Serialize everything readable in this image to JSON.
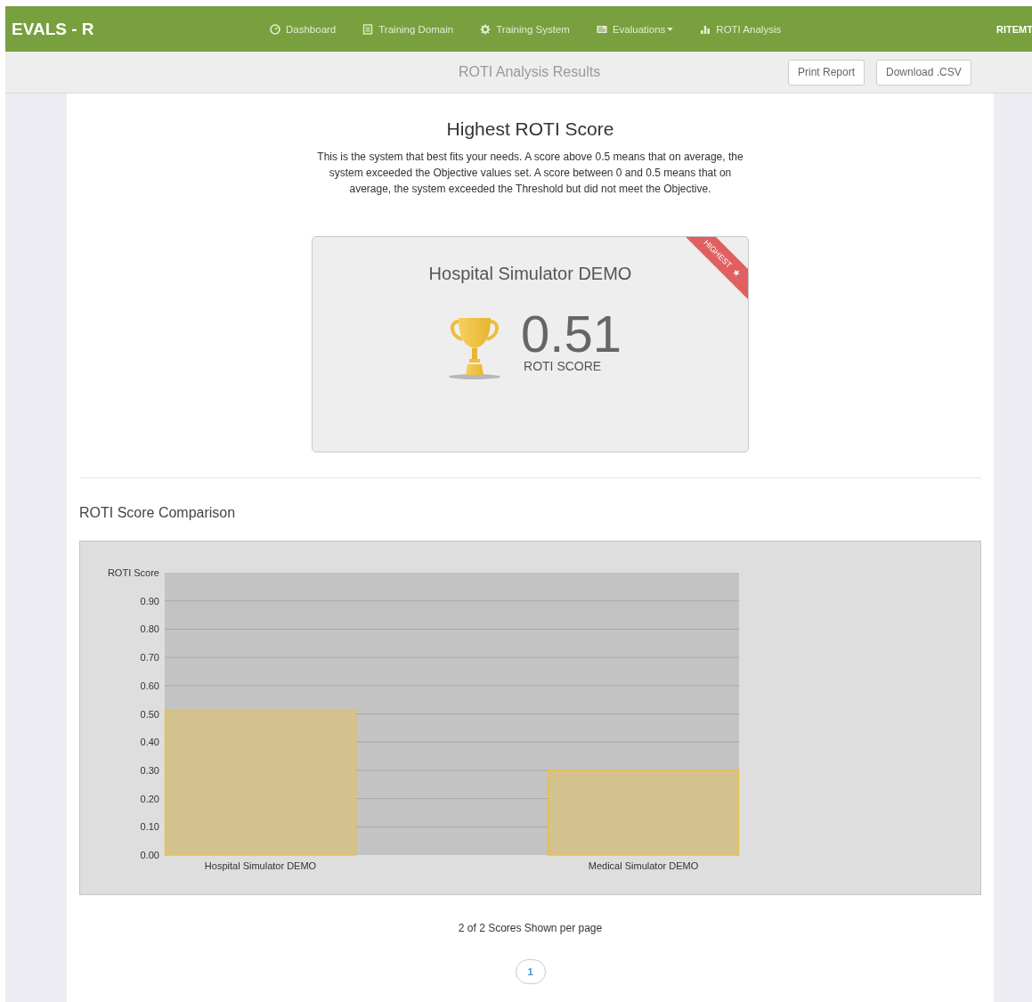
{
  "navbar": {
    "brand": "EVALS - R",
    "items": [
      {
        "label": "Dashboard",
        "dropdown": false
      },
      {
        "label": "Training Domain",
        "dropdown": false
      },
      {
        "label": "Training System",
        "dropdown": false
      },
      {
        "label": "Evaluations",
        "dropdown": true
      },
      {
        "label": "ROTI Analysis",
        "dropdown": false
      }
    ],
    "user": "RITEMT"
  },
  "subheader": {
    "title": "ROTI Analysis Results",
    "buttons": [
      "Print Report",
      "Download .CSV"
    ]
  },
  "highest": {
    "heading": "Highest ROTI Score",
    "description": "This is the system that best fits your needs. A score above 0.5 means that on average, the system exceeded the Objective values set. A score between 0 and 0.5 means that on average, the system exceeded the Threshold but did not meet the Objective.",
    "card": {
      "system": "Hospital Simulator DEMO",
      "score": "0.51",
      "score_label": "ROTI SCORE",
      "ribbon": "HIGHEST"
    }
  },
  "comparison": {
    "heading": "ROTI Score Comparison",
    "chart_data": {
      "type": "bar",
      "ylabel": "ROTI Score",
      "categories": [
        "Hospital Simulator DEMO",
        "Medical Simulator DEMO"
      ],
      "grid": true,
      "series": [
        {
          "color": "#d4c28e",
          "values": [
            0.51,
            0.3
          ]
        }
      ],
      "ylim": [
        0,
        1
      ],
      "yticks": [
        {
          "value": 0,
          "label": "0.00"
        },
        {
          "value": 0.1,
          "label": "0.10"
        },
        {
          "value": 0.2,
          "label": "0.20"
        },
        {
          "value": 0.3,
          "label": "0.30"
        },
        {
          "value": 0.4,
          "label": "0.40"
        },
        {
          "value": 0.5,
          "label": "0.50"
        },
        {
          "value": 0.6,
          "label": "0.60"
        },
        {
          "value": 0.7,
          "label": "0.70"
        },
        {
          "value": 0.8,
          "label": "0.80"
        },
        {
          "value": 0.9,
          "label": "0.90"
        }
      ]
    },
    "pager_text": "2 of 2 Scores Shown per page",
    "pages": [
      {
        "label": "1",
        "selected": true
      }
    ]
  }
}
